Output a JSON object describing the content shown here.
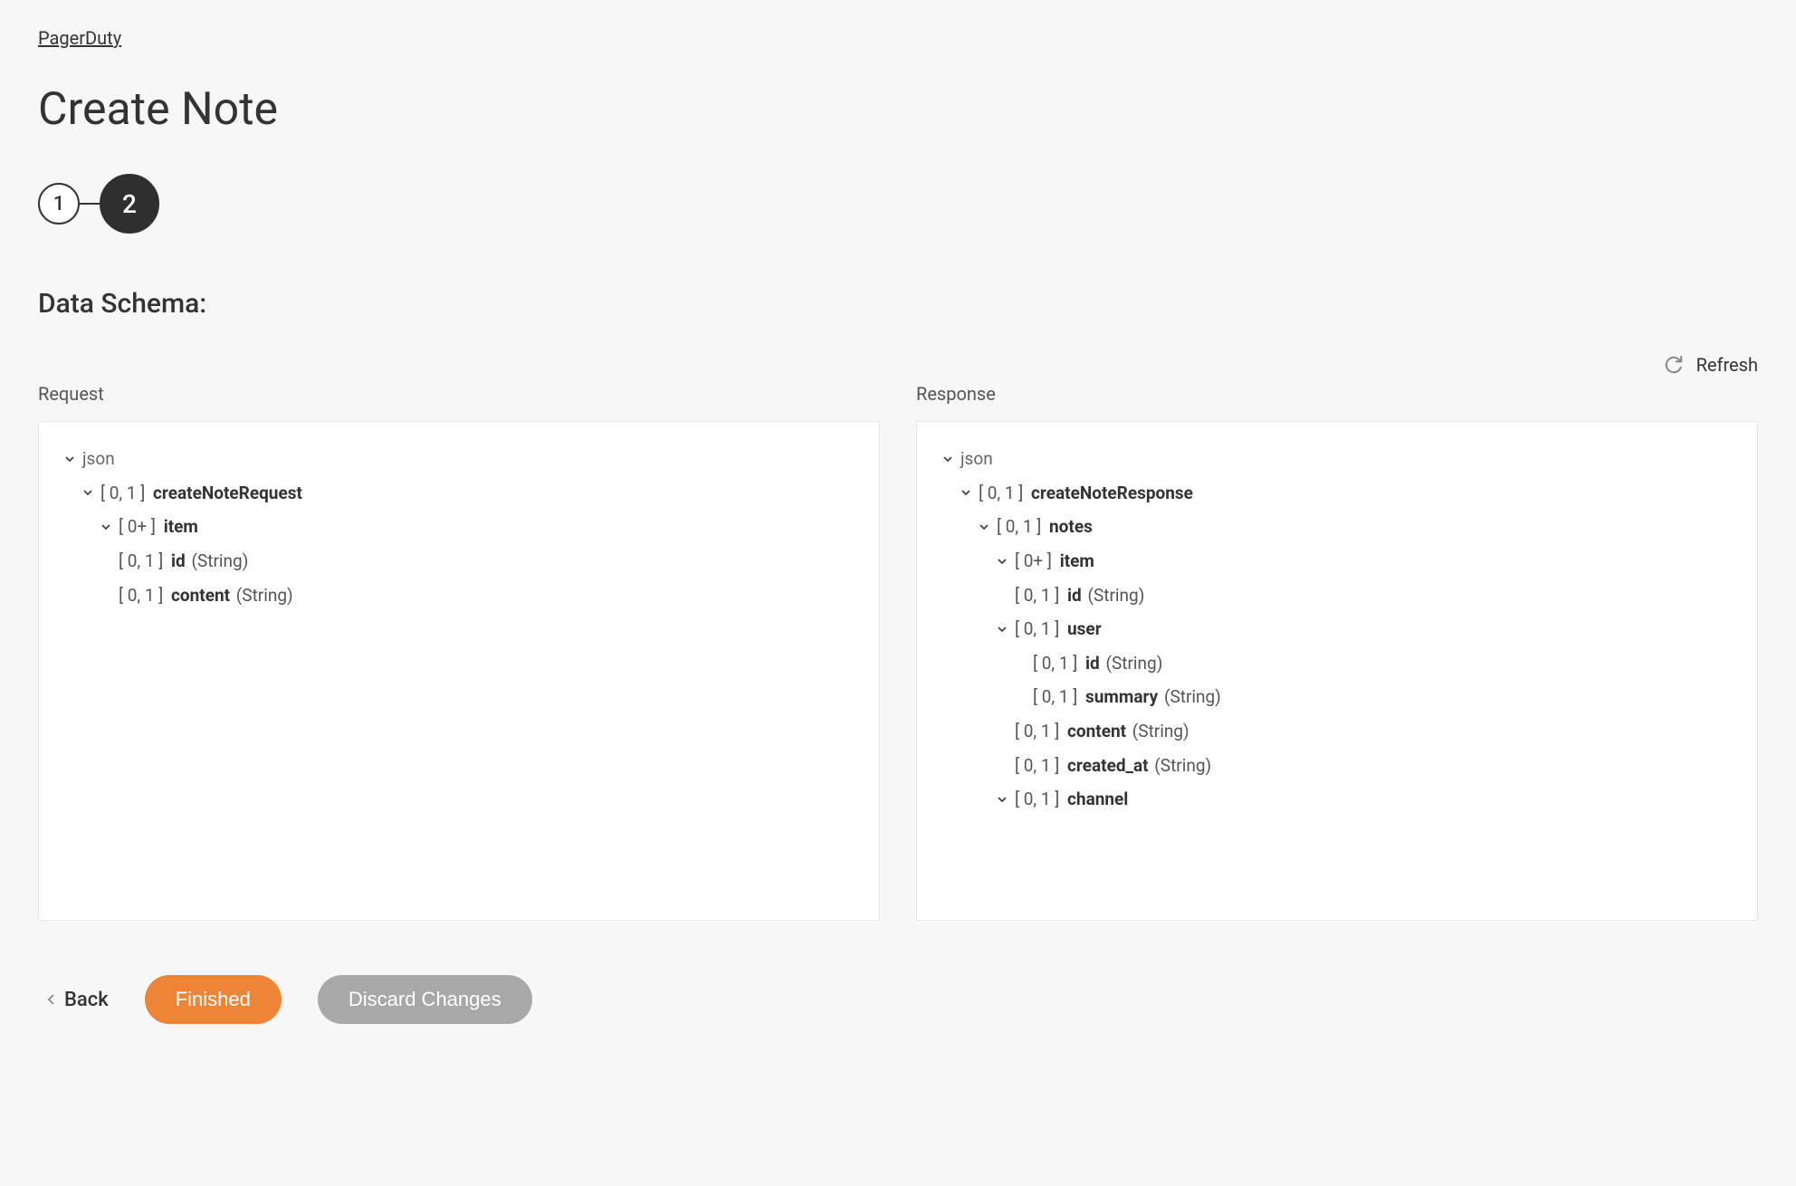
{
  "breadcrumb": {
    "label": "PagerDuty"
  },
  "page_title": "Create Note",
  "stepper": {
    "steps": [
      "1",
      "2"
    ],
    "active_index": 1
  },
  "section_title": "Data Schema:",
  "refresh": {
    "label": "Refresh"
  },
  "columns": {
    "request": {
      "header": "Request"
    },
    "response": {
      "header": "Response"
    }
  },
  "labels": {
    "json": "json",
    "card_01": "[ 0, 1 ]",
    "card_0plus": "[ 0+ ]",
    "type_string": "(String)"
  },
  "request_tree": {
    "root": "createNoteRequest",
    "item": "item",
    "id": "id",
    "content": "content"
  },
  "response_tree": {
    "root": "createNoteResponse",
    "notes": "notes",
    "item": "item",
    "id": "id",
    "user": "user",
    "summary": "summary",
    "content": "content",
    "created_at": "created_at",
    "channel": "channel"
  },
  "footer": {
    "back": "Back",
    "finished": "Finished",
    "discard": "Discard Changes"
  }
}
